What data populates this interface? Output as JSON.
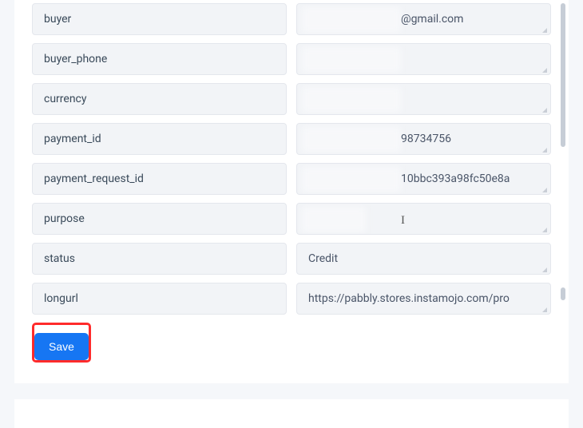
{
  "fields": [
    {
      "label": "buyer",
      "value": "@gmail.com",
      "redacted_prefix": true
    },
    {
      "label": "buyer_phone",
      "value": "",
      "redacted_prefix": true
    },
    {
      "label": "currency",
      "value": "",
      "redacted_prefix": true
    },
    {
      "label": "payment_id",
      "value": "98734756",
      "redacted_prefix": true
    },
    {
      "label": "payment_request_id",
      "value": "10bbc393a98fc50e8a",
      "redacted_prefix": true
    },
    {
      "label": "purpose",
      "value": "",
      "redacted_prefix": true
    },
    {
      "label": "status",
      "value": "Credit",
      "redacted_prefix": false
    },
    {
      "label": "longurl",
      "value": "https://pabbly.stores.instamojo.com/pro",
      "redacted_prefix": false
    }
  ],
  "buttons": {
    "save_label": "Save"
  },
  "colors": {
    "accent": "#1676f3",
    "highlight": "#ff2b2b",
    "field_bg": "#f2f4f7"
  }
}
